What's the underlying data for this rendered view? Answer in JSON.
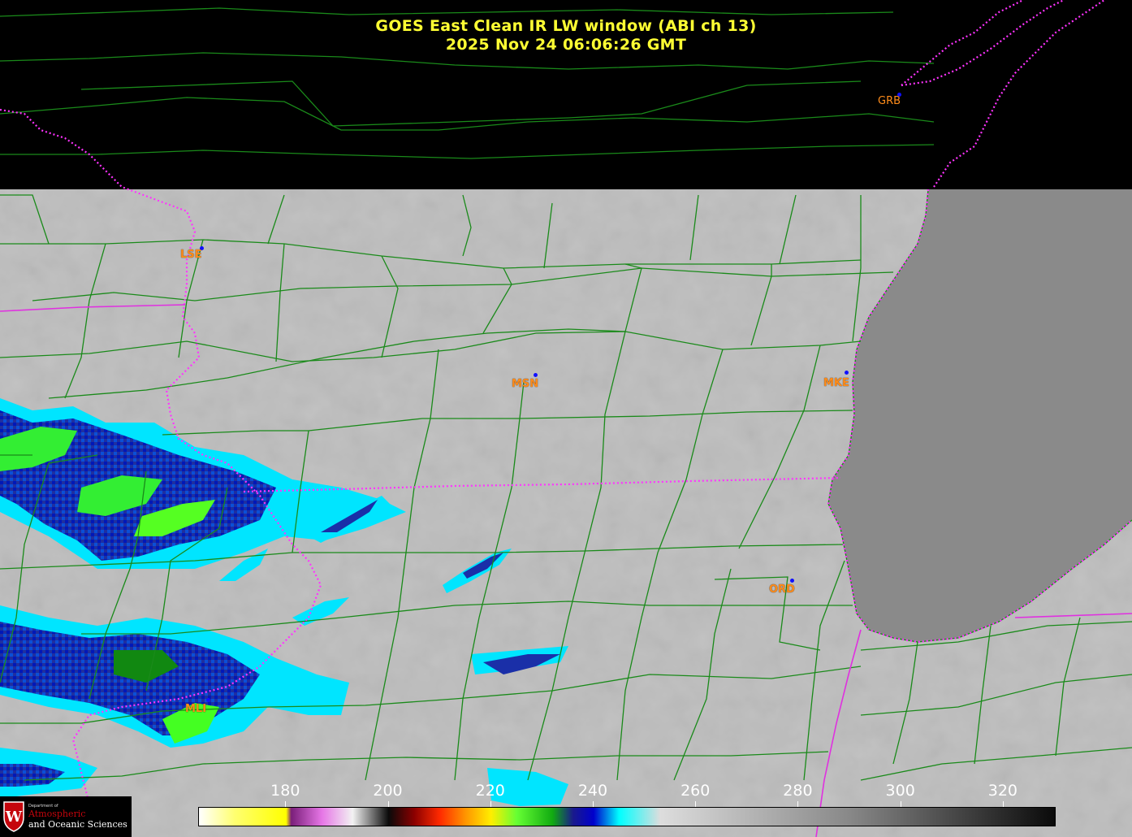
{
  "title": {
    "line1": "GOES East Clean IR LW window (ABI ch 13)",
    "line2": "2025 Nov 24  06:06:26 GMT"
  },
  "stations": [
    {
      "id": "GRB",
      "label": "GRB"
    },
    {
      "id": "LSE",
      "label": "LSE"
    },
    {
      "id": "MSN",
      "label": "MSN"
    },
    {
      "id": "MKE",
      "label": "MKE"
    },
    {
      "id": "ORD",
      "label": "ORD"
    },
    {
      "id": "MLI",
      "label": "MLI"
    }
  ],
  "colorbar": {
    "ticks": [
      "180",
      "200",
      "220",
      "240",
      "260",
      "280",
      "300",
      "320"
    ],
    "stops": [
      {
        "value": 163,
        "color": "#ffffff"
      },
      {
        "value": 170,
        "color": "#ffff70"
      },
      {
        "value": 180,
        "color": "#ffff00"
      },
      {
        "value": 181,
        "color": "#7a1f7a"
      },
      {
        "value": 187,
        "color": "#e676e6"
      },
      {
        "value": 193,
        "color": "#f2f2f2"
      },
      {
        "value": 200,
        "color": "#0a0a0a"
      },
      {
        "value": 205,
        "color": "#8b0000"
      },
      {
        "value": 210,
        "color": "#ff2a00"
      },
      {
        "value": 215,
        "color": "#ff9500"
      },
      {
        "value": 220,
        "color": "#ffee00"
      },
      {
        "value": 225,
        "color": "#66ff33"
      },
      {
        "value": 232,
        "color": "#11aa11"
      },
      {
        "value": 236,
        "color": "#1a1a8c"
      },
      {
        "value": 240,
        "color": "#0000cc"
      },
      {
        "value": 245,
        "color": "#00ffff"
      },
      {
        "value": 253,
        "color": "#dddddd"
      },
      {
        "value": 290,
        "color": "#888888"
      },
      {
        "value": 330,
        "color": "#0a0a0a"
      }
    ]
  },
  "colors": {
    "county_lines": "#1a8a1a",
    "state_lines": "#ff33ff",
    "station_label": "#ff8c1a",
    "title": "#ffff33",
    "land_gray": "#bdbdbd",
    "lake_gray": "#8a8a8a"
  },
  "logo": {
    "dept": "Department of",
    "line1": "Atmospheric",
    "line2": "and Oceanic Sciences"
  }
}
